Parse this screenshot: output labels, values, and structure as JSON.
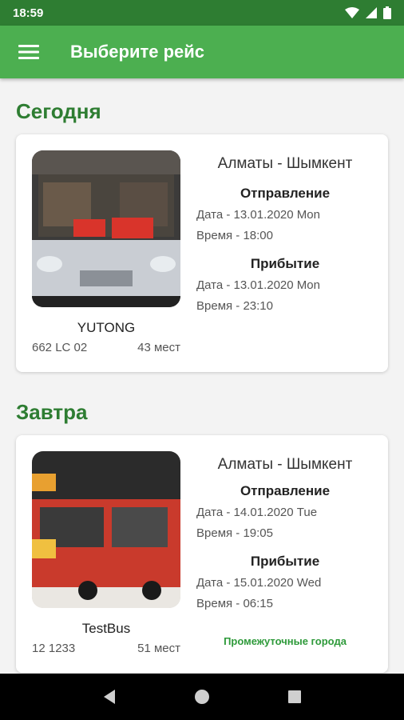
{
  "status": {
    "time": "18:59"
  },
  "app_bar": {
    "title": "Выберите рейс",
    "menu_icon": "hamburger-menu-icon"
  },
  "sections": [
    {
      "title": "Сегодня",
      "card": {
        "bus_name": "YUTONG",
        "plate": "662 LC 02",
        "seats": "43 мест",
        "route": "Алматы - Шымкент",
        "departure_title": "Отправление",
        "departure_date": "Дата  -  13.01.2020 Mon",
        "departure_time": "Время  -  18:00",
        "arrival_title": "Прибытие",
        "arrival_date": "Дата   -   13.01.2020 Mon",
        "arrival_time": "Время   -   23:10"
      }
    },
    {
      "title": "Завтра",
      "card": {
        "bus_name": "TestBus",
        "plate": "12 1233",
        "seats": "51 мест",
        "route": "Алматы - Шымкент",
        "departure_title": "Отправление",
        "departure_date": "Дата  -  14.01.2020 Tue",
        "departure_time": "Время  -  19:05",
        "arrival_title": "Прибытие",
        "arrival_date": "Дата   -   15.01.2020 Wed",
        "arrival_time": "Время   -   06:15",
        "intermediate_link": "Промежуточные города"
      }
    }
  ],
  "colors": {
    "status_bar": "#2e7d32",
    "app_bar": "#4caf50",
    "section_title": "#2e7d32",
    "link": "#2e9a3a"
  }
}
